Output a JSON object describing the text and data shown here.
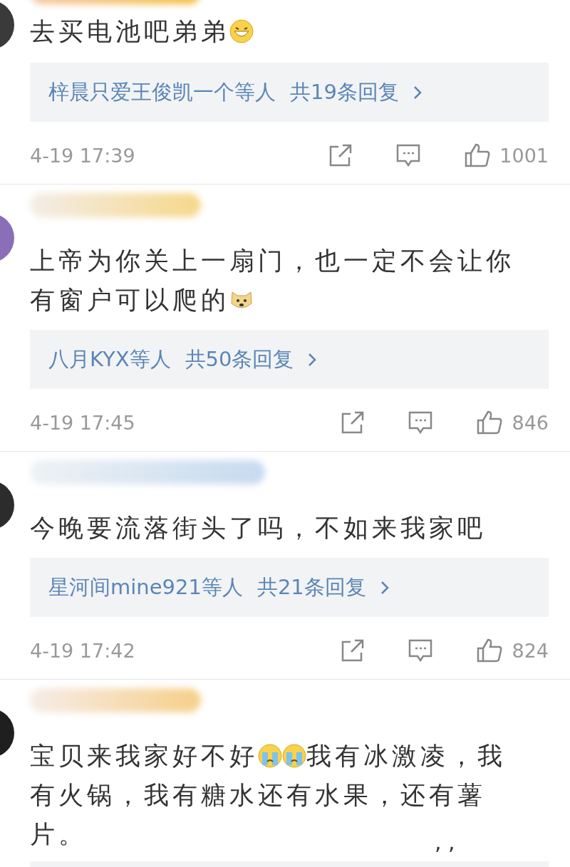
{
  "comments": [
    {
      "text_parts": [
        {
          "kind": "text",
          "text": "去买电池吧弟弟"
        },
        {
          "kind": "grin"
        }
      ],
      "replies": {
        "names": "梓晨只爱王俊凯一个等人",
        "count": "共19条回复"
      },
      "time": "4-19 17:39",
      "likes": "1001"
    },
    {
      "text_parts": [
        {
          "kind": "block",
          "text": "上帝为你关上一扇门，也一定不会让你"
        },
        {
          "kind": "text",
          "text": "有窗户可以爬的"
        },
        {
          "kind": "doge"
        }
      ],
      "replies": {
        "names": "八月KYX等人",
        "count": "共50条回复"
      },
      "time": "4-19 17:45",
      "likes": "846"
    },
    {
      "text_parts": [
        {
          "kind": "text",
          "text": "今晚要流落街头了吗，不如来我家吧"
        }
      ],
      "replies": {
        "names": "星河间mine921等人",
        "count": "共21条回复"
      },
      "time": "4-19 17:42",
      "likes": "824"
    },
    {
      "text_parts": [
        {
          "kind": "text",
          "text": "宝贝来我家好不好"
        },
        {
          "kind": "cry"
        },
        {
          "kind": "cry"
        },
        {
          "kind": "text",
          "text": "我有冰激凌，我"
        },
        {
          "kind": "block",
          "text": "有火锅，我有糖水还有水果，还有薯"
        },
        {
          "kind": "text",
          "text": "片。"
        }
      ],
      "trailing_marks": ", ,"
    }
  ]
}
